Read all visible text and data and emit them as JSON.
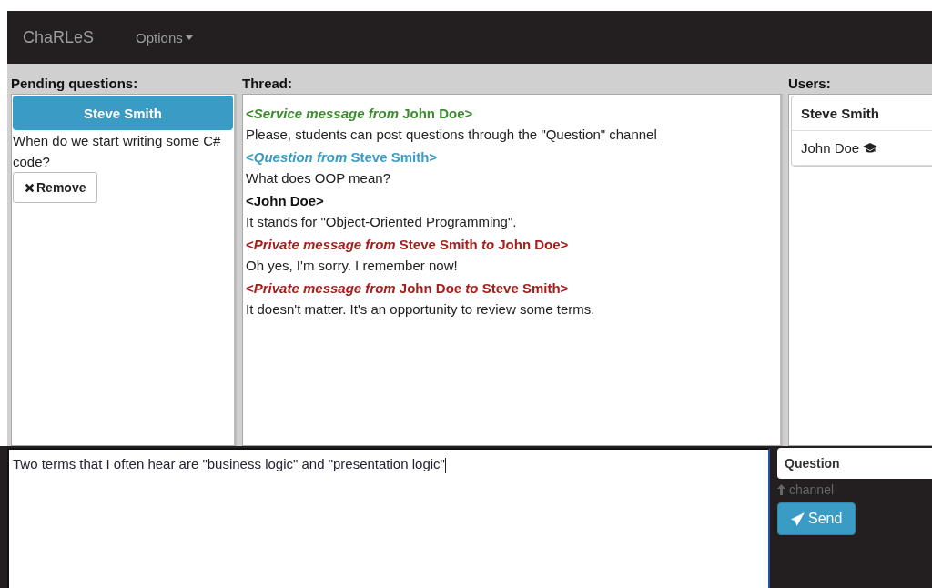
{
  "navbar": {
    "brand": "ChaRLeS",
    "menu": "Options"
  },
  "pending": {
    "title": "Pending questions:",
    "items": [
      {
        "author": "Steve Smith",
        "selected": true,
        "text": "When do we start writing some C# code?",
        "button": "Remove"
      }
    ]
  },
  "thread": {
    "title": "Thread:",
    "messages": [
      {
        "kind": "service",
        "header": "<*Service message from* John Doe>",
        "body": "Please, students can post questions through the \"Question\" channel"
      },
      {
        "kind": "question",
        "header": "<*Question from* Steve Smith>",
        "body": "What does OOP mean?"
      },
      {
        "kind": "plain",
        "header": "<John Doe>",
        "body": "It stands for \"Object-Oriented Programming\"."
      },
      {
        "kind": "private",
        "header": "<*Private message from* Steve Smith *to* John Doe>",
        "body": "Oh yes, I'm sorry. I remember now!"
      },
      {
        "kind": "private",
        "header": "<*Private message from* John Doe *to* Steve Smith>",
        "body": "It doesn't matter. It's an opportunity to review some terms."
      }
    ]
  },
  "users": {
    "title": "Users:",
    "items": [
      {
        "name": "Steve Smith",
        "selected": true,
        "teacher": false
      },
      {
        "name": "John Doe",
        "selected": false,
        "teacher": true
      }
    ]
  },
  "composer": {
    "value": "Two terms that I often hear are \"business logic\" and \"presentation logic\"",
    "channel": "Question",
    "channel_hint": "channel",
    "send": "Send"
  }
}
